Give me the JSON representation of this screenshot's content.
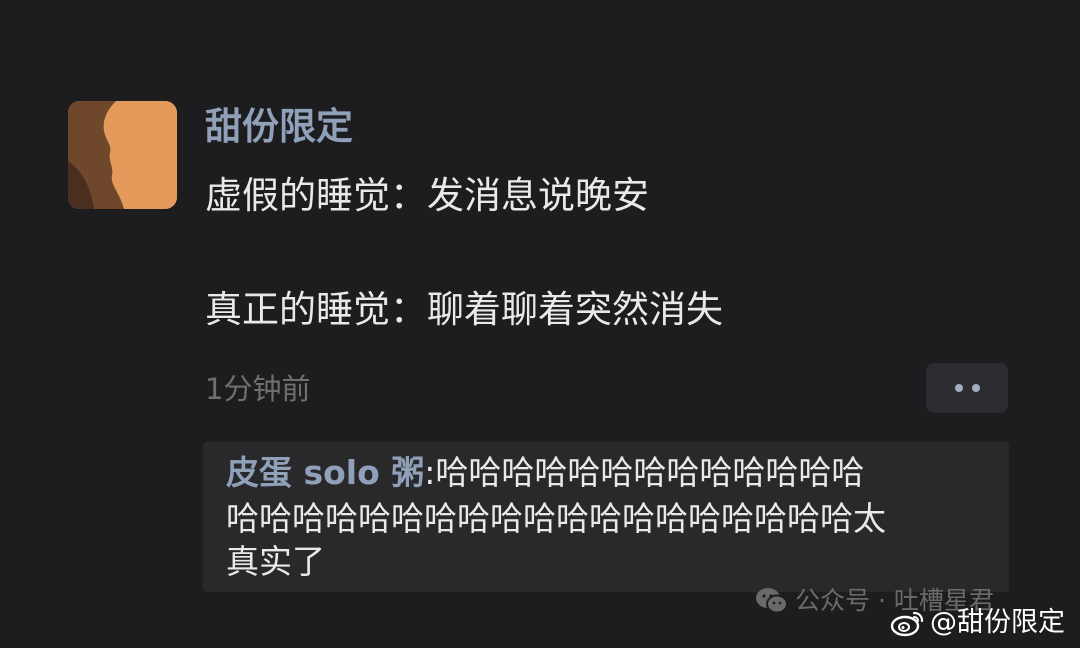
{
  "post": {
    "username": "甜份限定",
    "message_lines": [
      "虚假的睡觉：发消息说晚安",
      "真正的睡觉：聊着聊着突然消失"
    ],
    "timestamp": "1分钟前"
  },
  "comment": {
    "author": "皮蛋 solo 粥",
    "separator": ":",
    "lines": [
      "哈哈哈哈哈哈哈哈哈哈哈哈哈",
      "哈哈哈哈哈哈哈哈哈哈哈哈哈哈哈哈哈哈哈太",
      "真实了"
    ]
  },
  "watermarks": {
    "wechat": "公众号 · 吐槽星君",
    "weibo": "@甜份限定"
  },
  "icons": {
    "more": "more-dots-icon",
    "wechat": "wechat-icon",
    "weibo": "weibo-icon"
  },
  "colors": {
    "background": "#1d1d1f",
    "username": "#8fa0b8",
    "text": "#e9e9e9",
    "timestamp": "#6f6f72",
    "comment_bg": "#29292c",
    "avatar": "#e39a5a"
  }
}
